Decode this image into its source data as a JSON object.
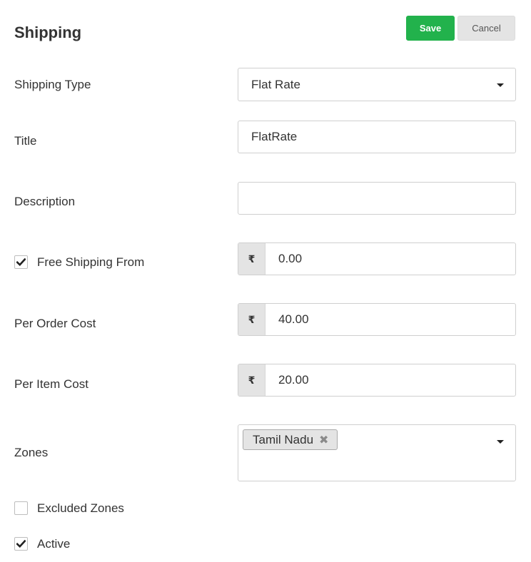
{
  "header": {
    "title": "Shipping",
    "save_label": "Save",
    "cancel_label": "Cancel"
  },
  "form": {
    "shipping_type": {
      "label": "Shipping Type",
      "value": "Flat Rate"
    },
    "title": {
      "label": "Title",
      "value": "FlatRate"
    },
    "description": {
      "label": "Description",
      "value": ""
    },
    "free_shipping_from": {
      "label": "Free Shipping From",
      "checked": true,
      "currency": "₹",
      "value": "0.00"
    },
    "per_order_cost": {
      "label": "Per Order Cost",
      "currency": "₹",
      "value": "40.00"
    },
    "per_item_cost": {
      "label": "Per Item Cost",
      "currency": "₹",
      "value": "20.00"
    },
    "zones": {
      "label": "Zones",
      "selected": [
        "Tamil Nadu"
      ],
      "remove_glyph": "✖"
    },
    "excluded_zones": {
      "label": "Excluded Zones",
      "checked": false
    },
    "active": {
      "label": "Active",
      "checked": true
    }
  },
  "icons": {
    "checkmark": "check-icon",
    "caret": "caret-down-icon",
    "remove": "close-icon"
  }
}
